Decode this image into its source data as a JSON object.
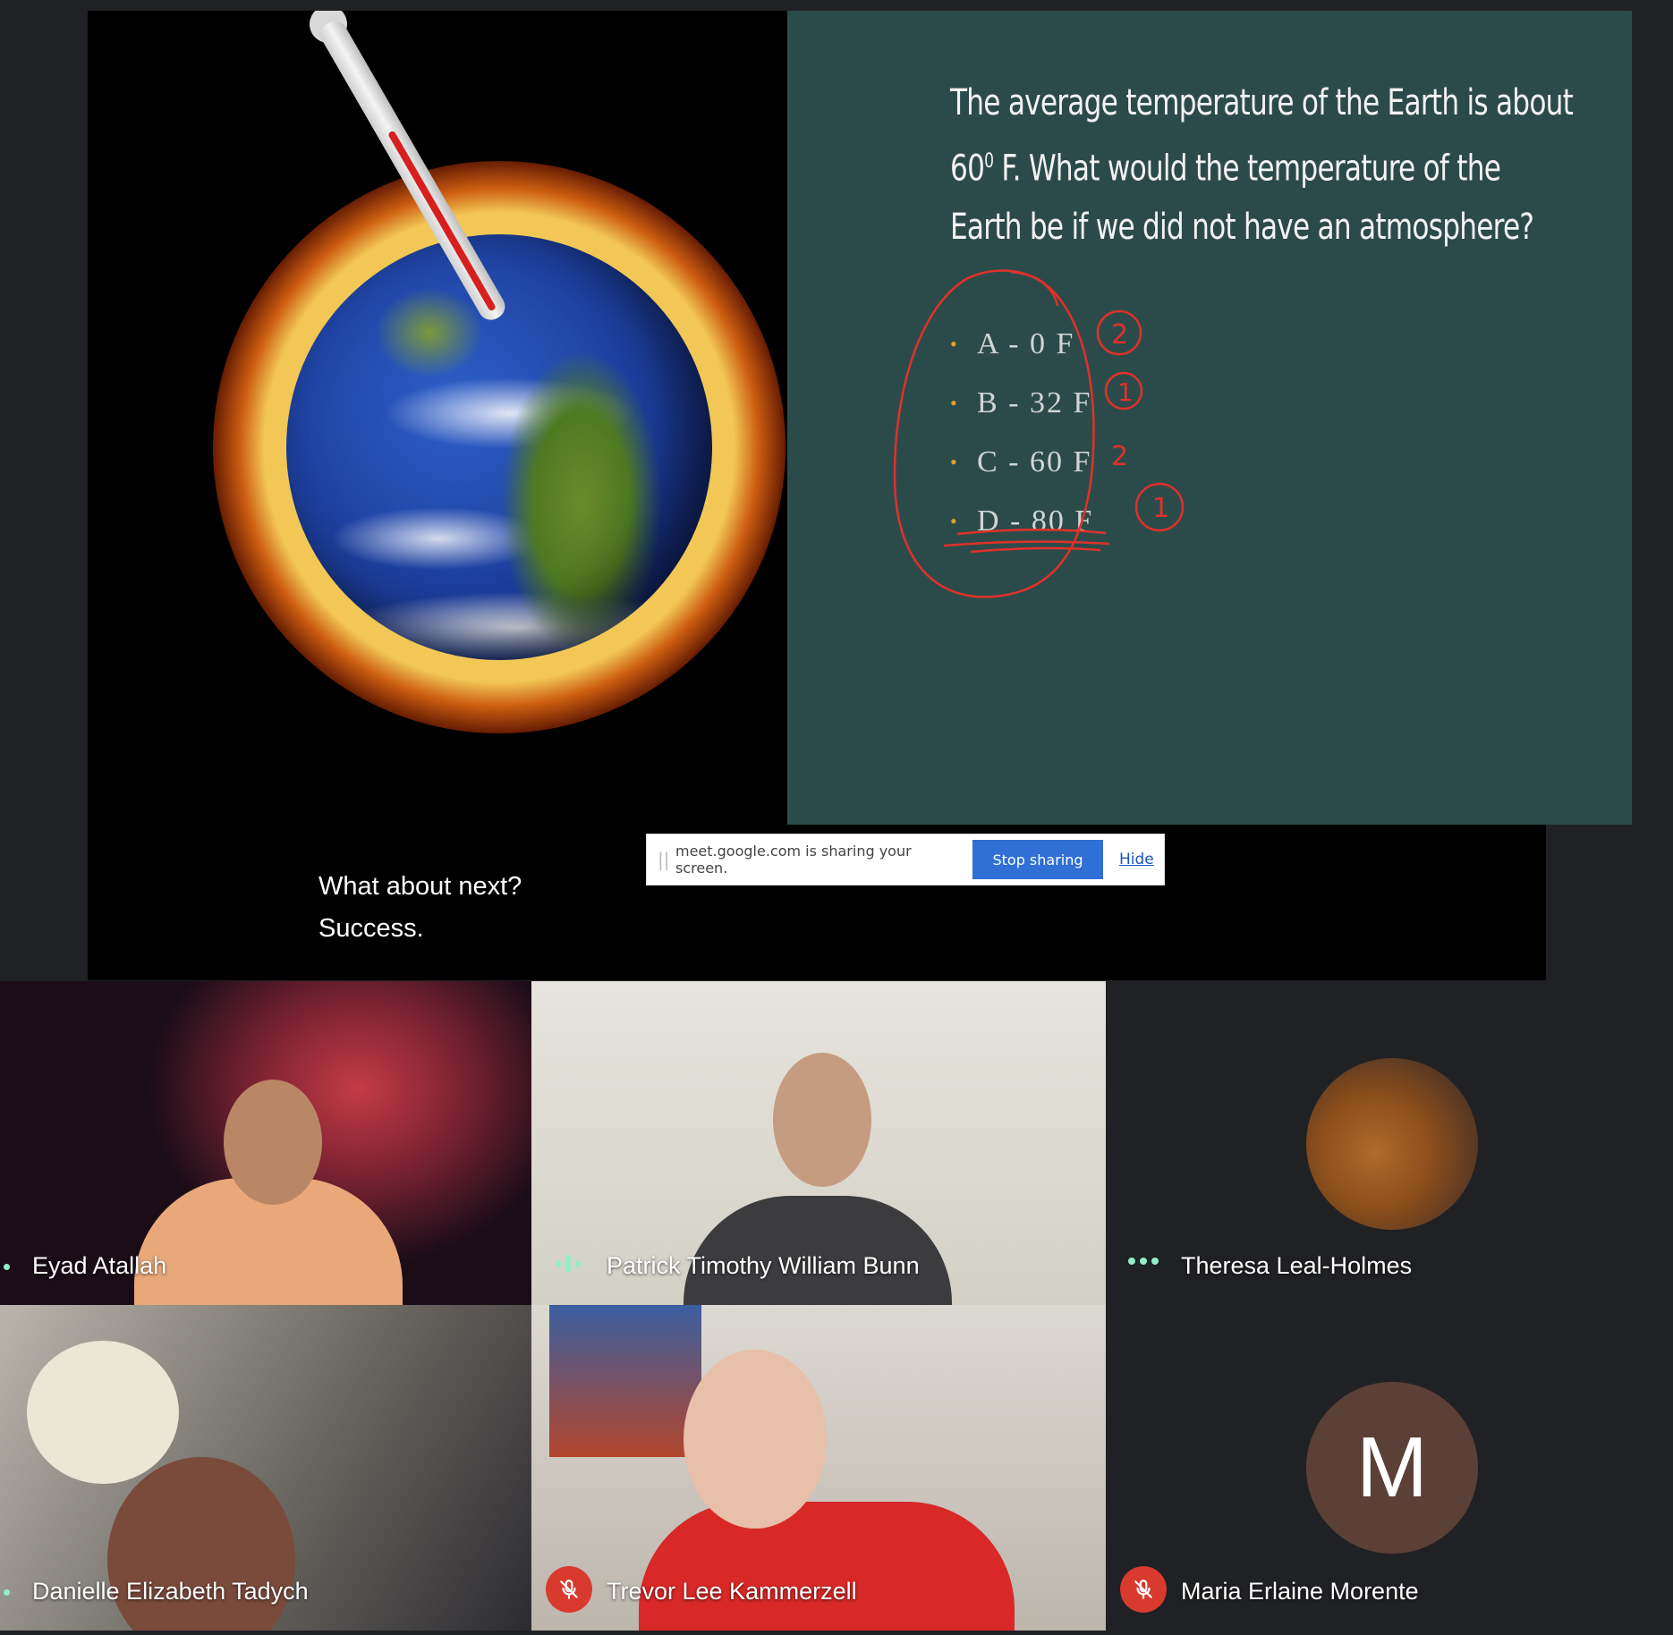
{
  "slide": {
    "question_line1": "The average temperature of the Earth is about",
    "question_line2_prefix": "60",
    "question_line2_sup": "0",
    "question_line2_suffix": " F. What would the temperature of the",
    "question_line3": "Earth be if we did not have an atmosphere?",
    "options": [
      "A - 0 F",
      "B - 32 F",
      "C - 60 F",
      "D - 80 F"
    ],
    "vote_marks": [
      "2",
      "1",
      "2",
      "1"
    ],
    "panel_color": "#2b4b4a",
    "annotation_color": "#e0302a"
  },
  "caption": {
    "line1": "What about next?",
    "line2": "Success."
  },
  "share_bar": {
    "grip": "||",
    "message": "meet.google.com is sharing your screen.",
    "stop_label": "Stop sharing",
    "hide_label": "Hide",
    "accent": "#2f6fd6"
  },
  "participants": [
    {
      "name": "Eyad Atallah",
      "status": "pinned-dot"
    },
    {
      "name": "Patrick Timothy William Bunn",
      "status": "speaking"
    },
    {
      "name": "Theresa Leal-Holmes",
      "status": "more-dots"
    },
    {
      "name": "Danielle Elizabeth Tadych",
      "status": "pinned-dot"
    },
    {
      "name": "Trevor Lee Kammerzell",
      "status": "muted"
    },
    {
      "name": "Maria Erlaine Morente",
      "status": "muted",
      "avatar_letter": "M",
      "avatar_color": "#5b4037"
    }
  ],
  "icons": {
    "speaking": "audio-level-icon",
    "muted": "mic-off-icon",
    "more": "more-dots-icon"
  }
}
